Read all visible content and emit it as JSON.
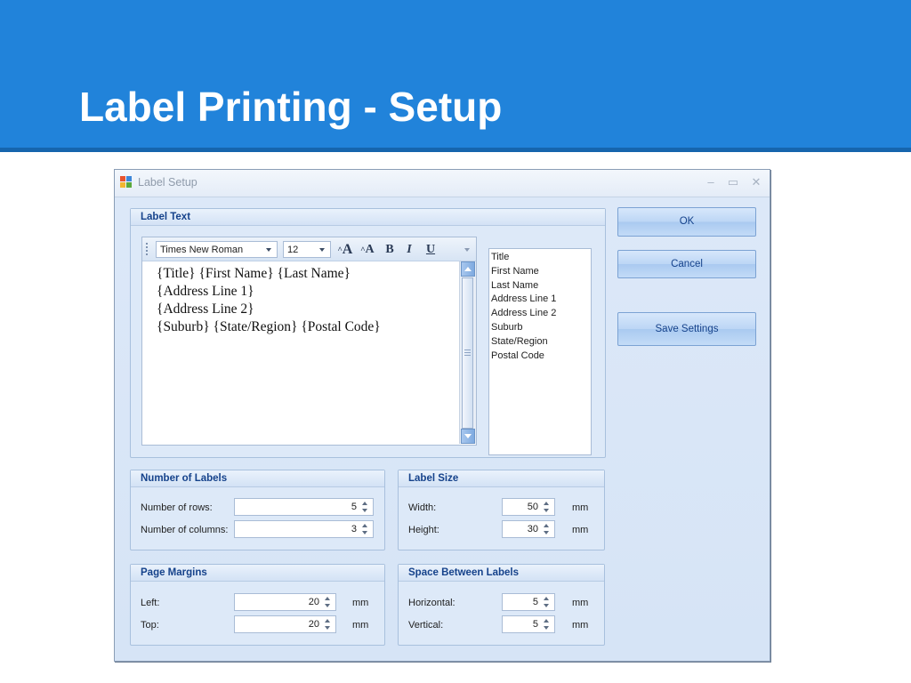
{
  "slide": {
    "title": "Label Printing - Setup"
  },
  "window": {
    "title": "Label Setup",
    "controls": {
      "minimize": "–",
      "maximize": "▭",
      "close": "✕"
    }
  },
  "label_text": {
    "group_title": "Label Text",
    "toolbar": {
      "font": "Times New Roman",
      "size": "12",
      "grow": "A",
      "shrink": "A",
      "bold": "B",
      "italic": "I",
      "underline": "U"
    },
    "lines": [
      "{Title} {First Name} {Last Name}",
      "{Address Line 1}",
      "{Address Line 2}",
      "{Suburb} {State/Region} {Postal Code}"
    ],
    "fields": [
      "Title",
      "First Name",
      "Last Name",
      "Address Line 1",
      "Address Line 2",
      "Suburb",
      "State/Region",
      "Postal Code"
    ]
  },
  "buttons": {
    "ok": "OK",
    "cancel": "Cancel",
    "save": "Save Settings"
  },
  "number_of_labels": {
    "title": "Number of Labels",
    "rows_label": "Number of rows:",
    "rows_value": "5",
    "columns_label": "Number of columns:",
    "columns_value": "3"
  },
  "label_size": {
    "title": "Label Size",
    "width_label": "Width:",
    "width_value": "50",
    "height_label": "Height:",
    "height_value": "30",
    "unit": "mm"
  },
  "page_margins": {
    "title": "Page Margins",
    "left_label": "Left:",
    "left_value": "20",
    "top_label": "Top:",
    "top_value": "20",
    "unit": "mm"
  },
  "space_between": {
    "title": "Space Between Labels",
    "horizontal_label": "Horizontal:",
    "horizontal_value": "5",
    "vertical_label": "Vertical:",
    "vertical_value": "5",
    "unit": "mm"
  },
  "colors": {
    "slide_header": "#2183da",
    "group_title_text": "#15428b",
    "window_bg": "#dbe7f7"
  }
}
